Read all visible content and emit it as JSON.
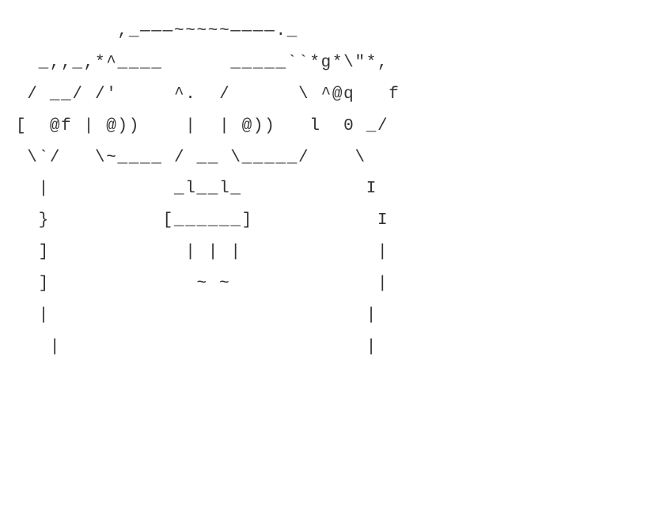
{
  "ascii_art": {
    "lines": [
      "         ,_———~~~~~————._",
      "  _,,_,*^____      _____``*g*\\\"*,",
      " / __/ /'     ^.  /      \\ ^@q   f",
      "[  @f | @))    |  | @))   l  0 _/",
      " \\`/   \\~____ / __ \\_____/    \\",
      "  |           _l__l_           I",
      "  }          [______]           I",
      "  ]            | | |            |",
      "  ]             ~ ~             |",
      "  |                            |",
      "   |                           |"
    ]
  }
}
